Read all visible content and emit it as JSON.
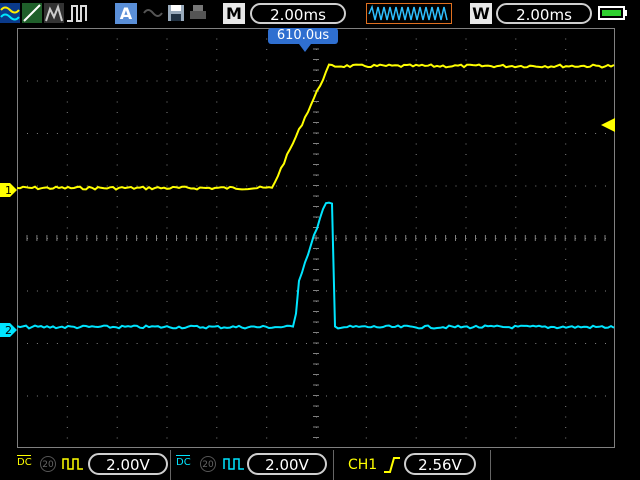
{
  "topbar": {
    "mode_letter": "M",
    "timebase": "2.00ms",
    "window_letter": "W",
    "window_timebase": "2.00ms",
    "auto_label": "A",
    "icons": [
      "measure-waveform-icon",
      "cursor-line-icon",
      "persistence-icon",
      "pulse-icon",
      "auto-icon",
      "ref-waveform-icon",
      "save-disk-icon",
      "print-icon",
      "battery-icon"
    ]
  },
  "trigger_time_label": "610.0us",
  "channels": [
    {
      "name": "CH1",
      "marker": "1",
      "color": "#ffff00",
      "coupling": "DC",
      "bw": "20",
      "scale": "2.00V"
    },
    {
      "name": "CH2",
      "marker": "2",
      "color": "#00e5ff",
      "coupling": "DC",
      "bw": "20",
      "scale": "2.00V"
    }
  ],
  "trigger": {
    "source": "CH1",
    "slope": "rising",
    "level": "2.56V"
  },
  "colors": {
    "ch1": "#ffff00",
    "ch2": "#00e5ff",
    "grid": "#808080",
    "accent": "#2f6fd0"
  }
}
